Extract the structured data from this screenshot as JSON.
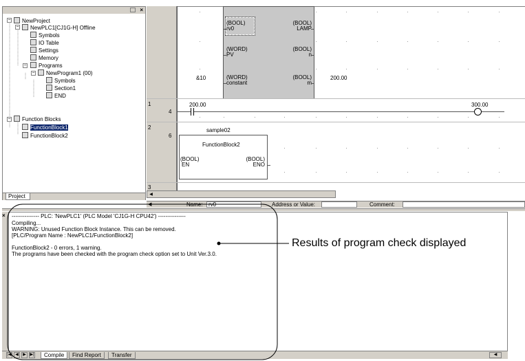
{
  "tree": {
    "root": "NewProject",
    "plc": "NewPLC1[CJ1G-H] Offline",
    "symbols": "Symbols",
    "io_table": "IO Table",
    "settings": "Settings",
    "memory": "Memory",
    "programs": "Programs",
    "program1": "NewProgram1 (00)",
    "program_symbols": "Symbols",
    "section1": "Section1",
    "end": "END",
    "function_blocks": "Function Blocks",
    "fb1": "FunctionBlock1",
    "fb2": "FunctionBlock2",
    "tab": "Project"
  },
  "ladder": {
    "top_block": {
      "in1_type": "(BOOL)",
      "in1_name": "rv0",
      "out1_type": "(BOOL)",
      "out1_name": "LAMP",
      "in2_type": "(WORD)",
      "in2_name": "PV",
      "out2_type": "(BOOL)",
      "out2_name": "n",
      "in3_type": "(WORD)",
      "in3_name": "constant",
      "out3_type": "(BOOL)",
      "out3_name": "m",
      "left_operand": "&10",
      "right_operand": "200.00"
    },
    "rung1": {
      "number": "1",
      "step": "4",
      "contact": "200.00",
      "coil": "300.00"
    },
    "rung2": {
      "number": "2",
      "step": "6",
      "instance": "sample02",
      "fb_name": "FunctionBlock2",
      "in_type": "(BOOL)",
      "in_name": "EN",
      "out_type": "(BOOL)",
      "out_name": "ENO"
    },
    "rung3": {
      "number": "3"
    }
  },
  "status": {
    "name_label": "Name:",
    "name_value": "rv0",
    "address_label": "Address or Value:",
    "comment_label": "Comment:"
  },
  "output": {
    "header": "--------------- PLC: 'NewPLC1' (PLC Model 'CJ1G-H CPU42') ---------------",
    "lines": [
      "Compiling...",
      "WARNING: Unused Function Block Instance. This can be removed.",
      "[PLC/Program Name : NewPLC1/FunctionBlock2]",
      "",
      "FunctionBlock2 - 0 errors, 1 warning.",
      "The programs have been checked with the program check option set to Unit Ver.3.0."
    ],
    "tabs": [
      "Compile",
      "Find Report",
      "Transfer"
    ]
  },
  "callout": "Results of program check displayed"
}
